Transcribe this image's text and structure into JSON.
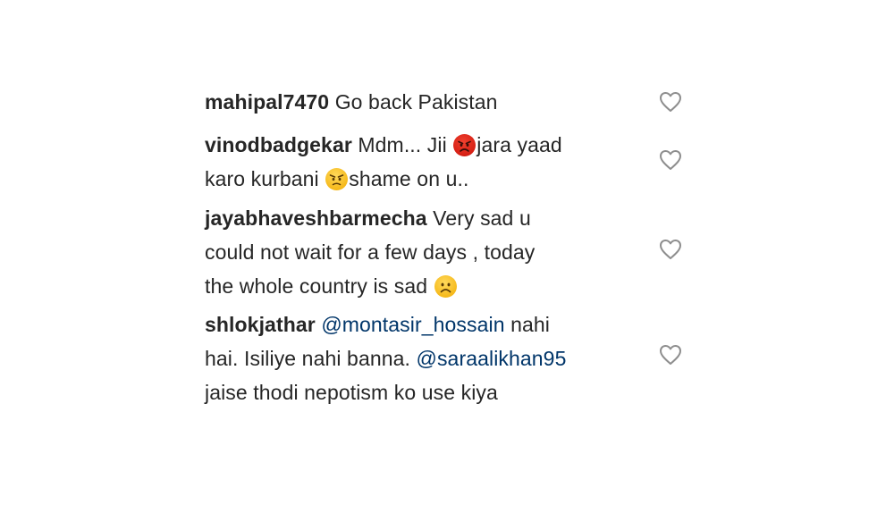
{
  "comments": [
    {
      "username": "mahipal7470",
      "text_1": "Go back Pakistan"
    },
    {
      "username": "vinodbadgekar",
      "text_1": "Mdm... Jii",
      "emoji_1": "angry-face-icon",
      "text_2": "jara yaad",
      "text_3": "karo kurbani",
      "emoji_2": "annoyed-face-icon",
      "text_4": "shame on u.."
    },
    {
      "username": "jayabhaveshbarmecha",
      "text_1": "Very sad u",
      "text_2": "could not wait for a few days , today",
      "text_3": "the whole country is sad",
      "emoji_1": "frowning-face-icon"
    },
    {
      "username": "shlokjathar",
      "mention_1": "@montasir_hossain",
      "text_1": "nahi",
      "text_2": "hai. Isiliye nahi banna.",
      "mention_2": "@saraalikhan95",
      "text_3": "jaise thodi nepotism ko use kiya"
    }
  ],
  "colors": {
    "text": "#262626",
    "mention": "#003569",
    "heart_outline": "#8e8e8e"
  }
}
